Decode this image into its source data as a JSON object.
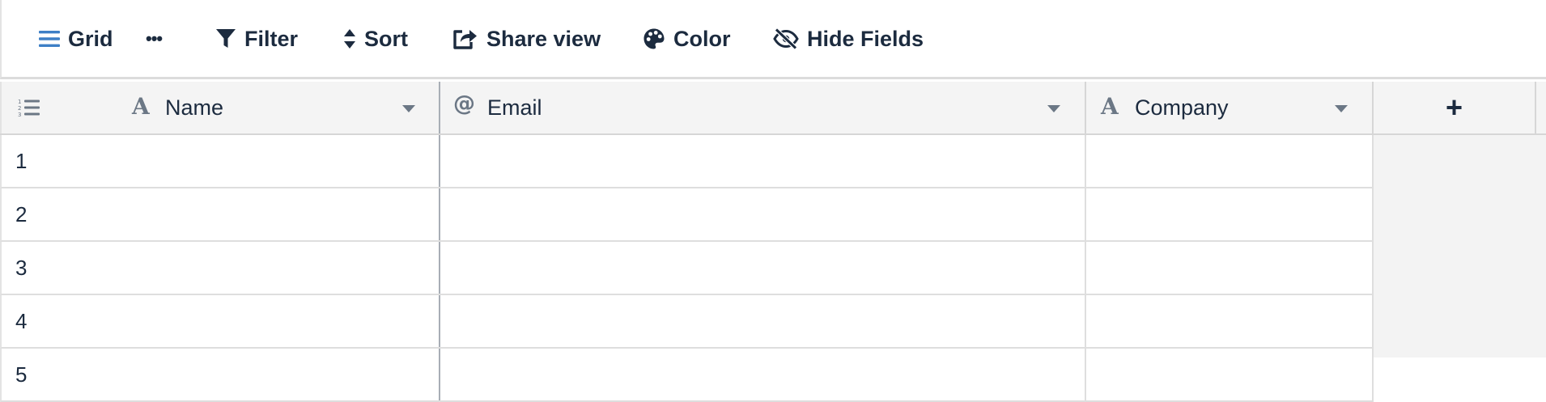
{
  "toolbar": {
    "grid_label": "Grid",
    "more_label": "•••",
    "filter_label": "Filter",
    "sort_label": "Sort",
    "share_label": "Share view",
    "color_label": "Color",
    "hide_fields_label": "Hide Fields"
  },
  "columns": [
    {
      "label": "Name",
      "type": "text"
    },
    {
      "label": "Email",
      "type": "email"
    },
    {
      "label": "Company",
      "type": "text"
    }
  ],
  "add_column_label": "+",
  "type_glyphs": {
    "text": "A",
    "email": "@"
  },
  "rows": [
    {
      "number": "1",
      "name": "",
      "email": "",
      "company": ""
    },
    {
      "number": "2",
      "name": "",
      "email": "",
      "company": ""
    },
    {
      "number": "3",
      "name": "",
      "email": "",
      "company": ""
    },
    {
      "number": "4",
      "name": "",
      "email": "",
      "company": ""
    },
    {
      "number": "5",
      "name": "",
      "email": "",
      "company": ""
    }
  ],
  "colors": {
    "accent_blue": "#3d7fc6",
    "text_dark": "#1c2b3f",
    "header_bg": "#f4f4f4",
    "grid_line": "#dedede",
    "icon_gray": "#6b7785"
  }
}
